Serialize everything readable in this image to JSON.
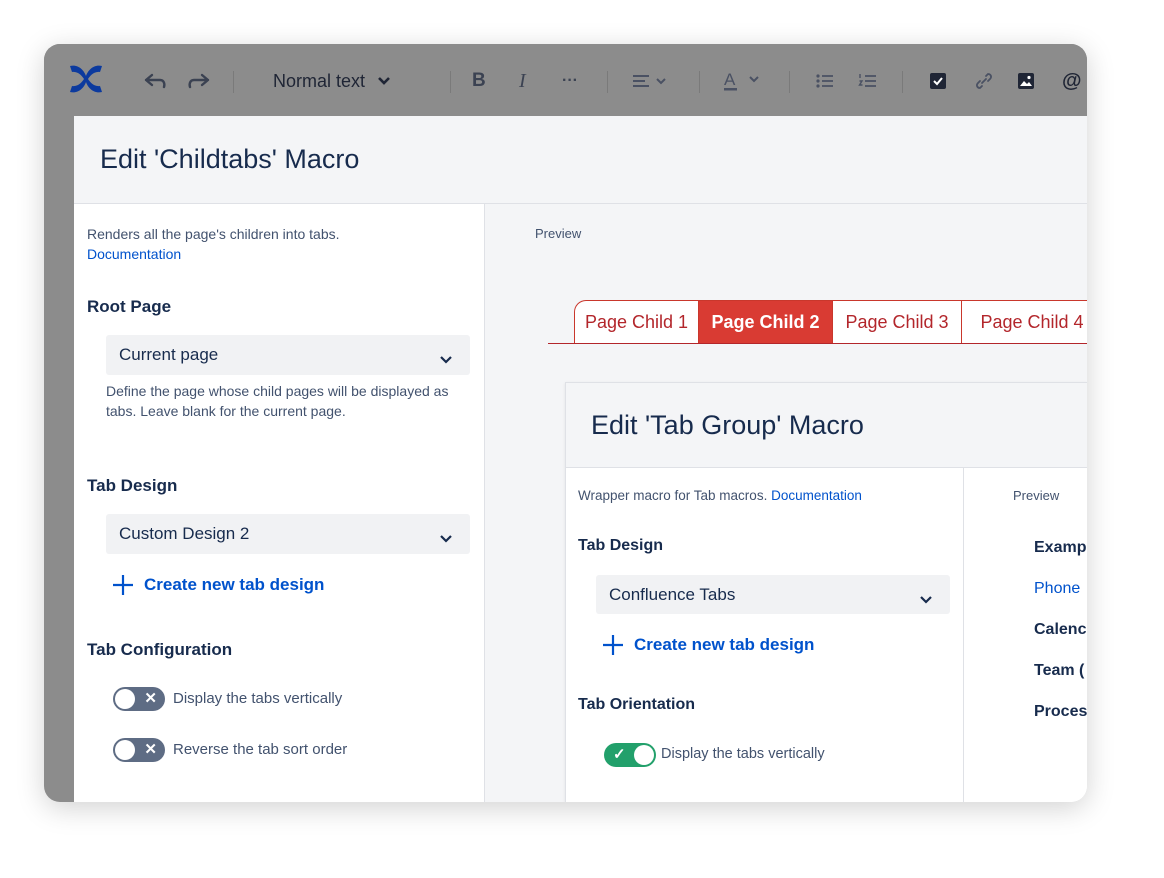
{
  "toolbar": {
    "items": [
      "confluence-logo",
      "undo",
      "redo",
      "text-style",
      "bold",
      "italic",
      "more",
      "align",
      "text-color",
      "bullet-list",
      "numbered-list",
      "task",
      "link",
      "image",
      "mention"
    ],
    "text_style": "Normal text",
    "bold": "B",
    "italic": "I",
    "more": "···",
    "mention": "@"
  },
  "dialog": {
    "title": "Edit 'Childtabs' Macro",
    "description": "Renders all the page's children into tabs.",
    "doc_link": "Documentation",
    "root_page": {
      "heading": "Root Page",
      "value": "Current page",
      "help": "Define the page whose child pages will be displayed as tabs. Leave blank for the current page."
    },
    "tab_design": {
      "heading": "Tab Design",
      "value": "Custom Design 2",
      "create": "Create new tab design"
    },
    "tab_config": {
      "heading": "Tab Configuration",
      "toggles": [
        {
          "label": "Display the tabs vertically",
          "on": false
        },
        {
          "label": "Reverse the tab sort order",
          "on": false
        }
      ]
    },
    "preview_label": "Preview",
    "tabs": [
      {
        "label": "Page Child 1",
        "active": false
      },
      {
        "label": "Page Child 2",
        "active": true
      },
      {
        "label": "Page Child 3",
        "active": false
      },
      {
        "label": "Page Child 4",
        "active": false
      }
    ]
  },
  "nested": {
    "title": "Edit 'Tab Group' Macro",
    "description": "Wrapper macro for Tab macros.",
    "doc_link": "Documentation",
    "tab_design": {
      "heading": "Tab Design",
      "value": "Confluence Tabs",
      "create": "Create new tab design"
    },
    "orientation": {
      "heading": "Tab Orientation",
      "toggle_label": "Display the tabs vertically",
      "on": true
    },
    "preview_label": "Preview",
    "preview_items": [
      {
        "text": "Examp",
        "link": false
      },
      {
        "text": "Phone",
        "link": true
      },
      {
        "text": "Calenc",
        "link": false
      },
      {
        "text": "Team (",
        "link": false
      },
      {
        "text": "Proces",
        "link": false
      }
    ]
  },
  "colors": {
    "accent_link": "#0052cc",
    "tab_red": "#d93b33",
    "toggle_on": "#22a06b",
    "toggle_off": "#5e6c84"
  }
}
